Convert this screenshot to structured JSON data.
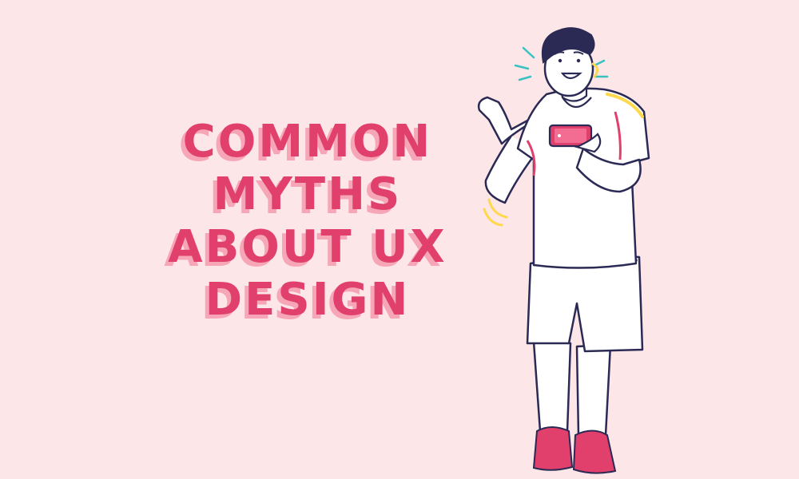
{
  "headline": {
    "lines": [
      "COMMON",
      "MYTHS",
      "ABOUT UX",
      "DESIGN"
    ]
  },
  "colors": {
    "background": "#fde6e8",
    "text_primary": "#e0406b",
    "text_shadow": "#f6a6b7",
    "outline": "#2b2a55",
    "hair": "#2b2a55",
    "clothing": "#ffffff",
    "accent": "#ffd84d",
    "sparkle": "#39c1c1",
    "shoes": "#e0406b"
  },
  "illustration": {
    "subject": "man-holding-phone",
    "icons": [
      "sparkle-lines-icon",
      "motion-lines-icon",
      "phone-icon"
    ]
  }
}
